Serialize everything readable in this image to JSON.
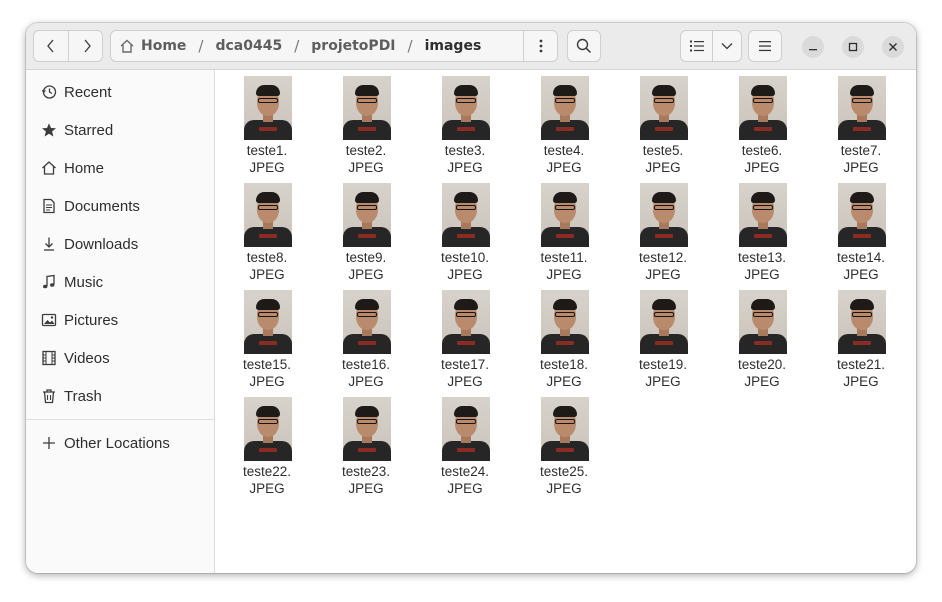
{
  "toolbar": {
    "back_icon": "chevron-left-icon",
    "forward_icon": "chevron-right-icon",
    "path": [
      {
        "label": "Home"
      },
      {
        "label": "dca0445"
      },
      {
        "label": "projetoPDI"
      },
      {
        "label": "images"
      }
    ],
    "separator": "/"
  },
  "sidebar": {
    "items": [
      {
        "label": "Recent",
        "icon": "clock-icon"
      },
      {
        "label": "Starred",
        "icon": "star-icon"
      },
      {
        "label": "Home",
        "icon": "home-icon"
      },
      {
        "label": "Documents",
        "icon": "document-icon"
      },
      {
        "label": "Downloads",
        "icon": "download-icon"
      },
      {
        "label": "Music",
        "icon": "music-icon"
      },
      {
        "label": "Pictures",
        "icon": "picture-icon"
      },
      {
        "label": "Videos",
        "icon": "film-icon"
      },
      {
        "label": "Trash",
        "icon": "trash-icon"
      }
    ],
    "other_locations": {
      "label": "Other Locations",
      "icon": "plus-icon"
    }
  },
  "files": [
    {
      "line1": "teste1.",
      "line2": "JPEG"
    },
    {
      "line1": "teste2.",
      "line2": "JPEG"
    },
    {
      "line1": "teste3.",
      "line2": "JPEG"
    },
    {
      "line1": "teste4.",
      "line2": "JPEG"
    },
    {
      "line1": "teste5.",
      "line2": "JPEG"
    },
    {
      "line1": "teste6.",
      "line2": "JPEG"
    },
    {
      "line1": "teste7.",
      "line2": "JPEG"
    },
    {
      "line1": "teste8.",
      "line2": "JPEG"
    },
    {
      "line1": "teste9.",
      "line2": "JPEG"
    },
    {
      "line1": "teste10.",
      "line2": "JPEG"
    },
    {
      "line1": "teste11.",
      "line2": "JPEG"
    },
    {
      "line1": "teste12.",
      "line2": "JPEG"
    },
    {
      "line1": "teste13.",
      "line2": "JPEG"
    },
    {
      "line1": "teste14.",
      "line2": "JPEG"
    },
    {
      "line1": "teste15.",
      "line2": "JPEG"
    },
    {
      "line1": "teste16.",
      "line2": "JPEG"
    },
    {
      "line1": "teste17.",
      "line2": "JPEG"
    },
    {
      "line1": "teste18.",
      "line2": "JPEG"
    },
    {
      "line1": "teste19.",
      "line2": "JPEG"
    },
    {
      "line1": "teste20.",
      "line2": "JPEG"
    },
    {
      "line1": "teste21.",
      "line2": "JPEG"
    },
    {
      "line1": "teste22.",
      "line2": "JPEG"
    },
    {
      "line1": "teste23.",
      "line2": "JPEG"
    },
    {
      "line1": "teste24.",
      "line2": "JPEG"
    },
    {
      "line1": "teste25.",
      "line2": "JPEG"
    }
  ]
}
